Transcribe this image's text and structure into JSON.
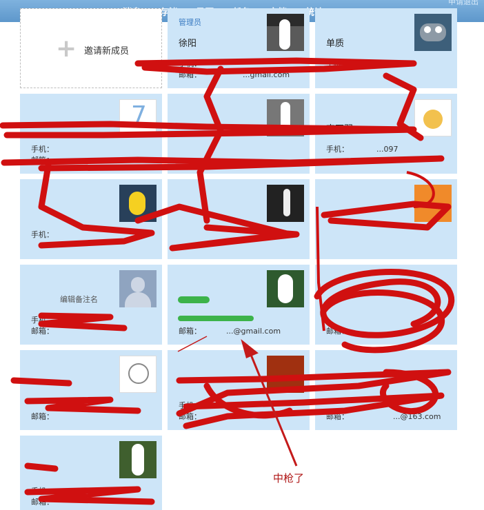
{
  "nav": [
    "消息",
    "存储",
    "日历",
    "任务",
    "文档",
    "统计"
  ],
  "top_right": "申请退出",
  "invite_label": "邀请新成员",
  "admin_label": "管理员",
  "phone_prefix": "手机：",
  "mail_prefix": "邮箱：",
  "edit_note_label": "编辑备注名",
  "members": [
    {
      "name": "徐阳",
      "mail": "...gmail.com",
      "avatar": "photo"
    },
    {
      "name": "单质",
      "avatar": "robot"
    },
    {
      "name": "李石羽",
      "phone": "...097",
      "avatar": "cat"
    },
    {
      "mail": "...@gmail.com",
      "note": "编辑备注名"
    },
    {
      "phone": "...7",
      "mail": "...@163.com"
    }
  ],
  "annotation": "中枪了",
  "colors": {
    "nav_bg": "#6aa3d6",
    "card_bg": "#cde5f8",
    "scribble": "#d01010"
  }
}
